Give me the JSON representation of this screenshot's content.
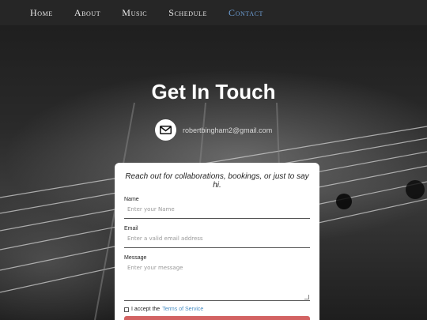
{
  "nav": {
    "items": [
      {
        "label": "Home"
      },
      {
        "label": "About"
      },
      {
        "label": "Music"
      },
      {
        "label": "Schedule"
      },
      {
        "label": "Contact"
      }
    ],
    "active": "Contact"
  },
  "hero": {
    "title": "Get In Touch",
    "email": "robertbingham2@gmail.com"
  },
  "form": {
    "tagline": "Reach out for collaborations, bookings, or just to say hi.",
    "name_label": "Name",
    "name_placeholder": "Enter your Name",
    "email_label": "Email",
    "email_placeholder": "Enter a valid email address",
    "message_label": "Message",
    "message_placeholder": "Enter your message",
    "terms_prefix": "I accept the",
    "terms_link": "Terms of Service",
    "terms_checked": false
  },
  "colors": {
    "nav_bg": "#262626",
    "nav_active": "#6e9fd6",
    "submit_bg": "#d36363",
    "link": "#4a8fc4"
  },
  "icons": {
    "contact": "envelope-icon"
  }
}
